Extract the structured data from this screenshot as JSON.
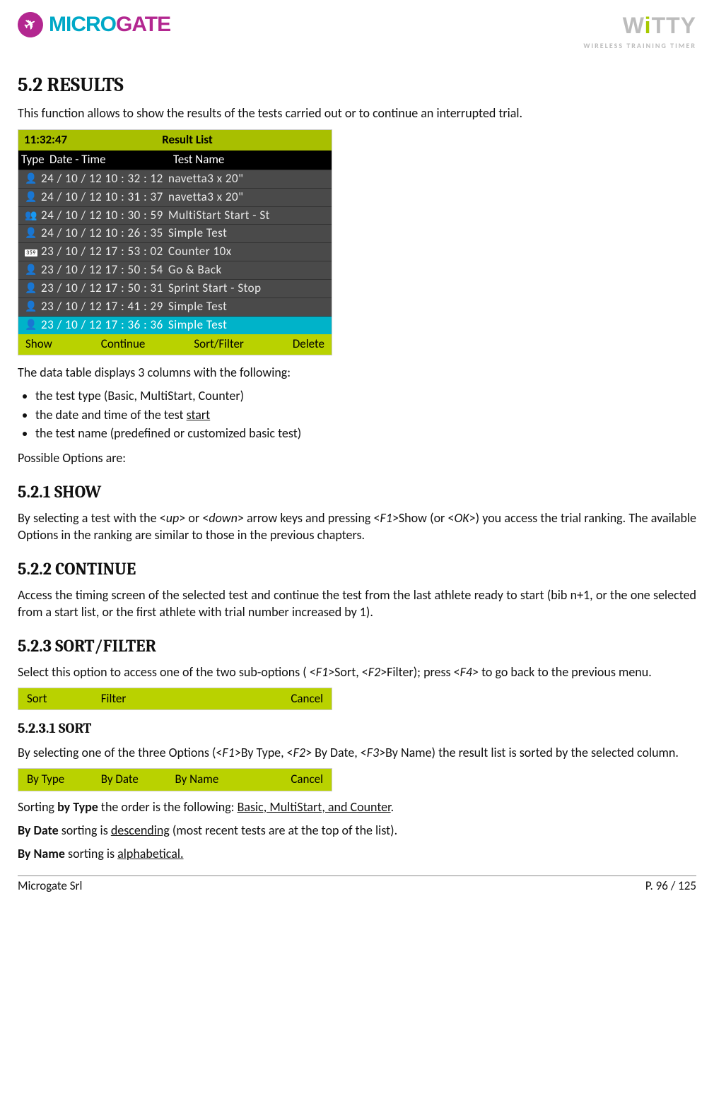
{
  "header": {
    "brand_left_1": "MICRO",
    "brand_left_2": "GATE",
    "brand_right_main_1": "W",
    "brand_right_main_i": "i",
    "brand_right_main_2": "TTY",
    "brand_right_sub": "WIRELESS TRAINING TIMER"
  },
  "h52": "5.2  RESULTS",
  "p_intro": "This function allows to show the results of the tests carried out or to continue an interrupted trial.",
  "device": {
    "time": "11:32:47",
    "title": "Result  List",
    "cols": {
      "type": "Type",
      "date": "Date - Time",
      "name": "Test  Name"
    },
    "rows": [
      {
        "icon": "person",
        "dt": "24 / 10 / 12   10 : 32 : 12",
        "nm": "navetta3 x 20\"",
        "sel": false
      },
      {
        "icon": "person",
        "dt": "24 / 10 / 12   10 : 31 : 37",
        "nm": "navetta3 x 20\"",
        "sel": false
      },
      {
        "icon": "multi",
        "dt": "24 / 10 / 12   10 : 30 : 59",
        "nm": "MultiStart  Start - St",
        "sel": false
      },
      {
        "icon": "person",
        "dt": "24 / 10 / 12   10 : 26 : 35",
        "nm": "Simple  Test",
        "sel": false
      },
      {
        "icon": "counter",
        "dt": "23 / 10 / 12   17 : 53 : 02",
        "nm": "Counter  10x",
        "sel": false
      },
      {
        "icon": "person",
        "dt": "23 / 10 / 12   17 : 50 : 54",
        "nm": "Go  &  Back",
        "sel": false
      },
      {
        "icon": "person",
        "dt": "23 / 10 / 12   17 : 50 : 31",
        "nm": "Sprint  Start - Stop",
        "sel": false
      },
      {
        "icon": "person",
        "dt": "23 / 10 / 12   17 : 41 : 29",
        "nm": "Simple  Test",
        "sel": false
      },
      {
        "icon": "person",
        "dt": "23 / 10 / 12   17 : 36 : 36",
        "nm": "Simple  Test",
        "sel": true
      }
    ],
    "footer": [
      "Show",
      "Continue",
      "Sort/Filter",
      "Delete"
    ]
  },
  "p_cols_intro": "The data table displays 3 columns with the following:",
  "bullets": [
    "the test type (Basic, MultiStart, Counter)",
    "the date and time of the test ",
    "the test name (predefined or customized basic test)"
  ],
  "bullet2_u": "start",
  "p_opts": "Possible Options are:",
  "h521": "5.2.1 SHOW",
  "p521a": "By selecting a test with the <up> or <down> arrow keys and pressing <F1>Show (or <OK>) you access the trial ranking. The available Options in the ranking are similar to those in the previous chapters.",
  "h522": "5.2.2 CONTINUE",
  "p522": "Access the timing screen of the selected test and continue the test from the last athlete ready to start (bib n+1, or the one selected from a start list, or  the first athlete with trial number increased by 1).",
  "h523": "5.2.3 SORT/FILTER",
  "p523": "Select this option to access one of the two sub-options ( <F1>Sort, <F2>Filter); press <F4> to go back to the previous menu.",
  "bar1": [
    "Sort",
    "Filter",
    "",
    "Cancel"
  ],
  "h5231": "5.2.3.1  SORT",
  "p5231": "By selecting one of the three Options (<F1>By Type, <F2> By Date, <F3>By Name) the result list is sorted by the selected column.",
  "bar2": [
    "By  Type",
    "By  Date",
    "By  Name",
    "Cancel"
  ],
  "p_sort_type_1": "Sorting ",
  "p_sort_type_b": "by Type",
  "p_sort_type_2": " the order is the following: ",
  "p_sort_type_u": "Basic, MultiStart, and Counter",
  "p_sort_type_3": ".",
  "p_sort_date_b": "By Date",
  "p_sort_date_1": " sorting is ",
  "p_sort_date_u": "descending",
  "p_sort_date_2": " (most recent tests are at the top of the list).",
  "p_sort_name_b": "By Name",
  "p_sort_name_1": " sorting is ",
  "p_sort_name_u": "alphabetical.",
  "footer": {
    "left": "Microgate Srl",
    "right": "P. 96 / 125"
  }
}
